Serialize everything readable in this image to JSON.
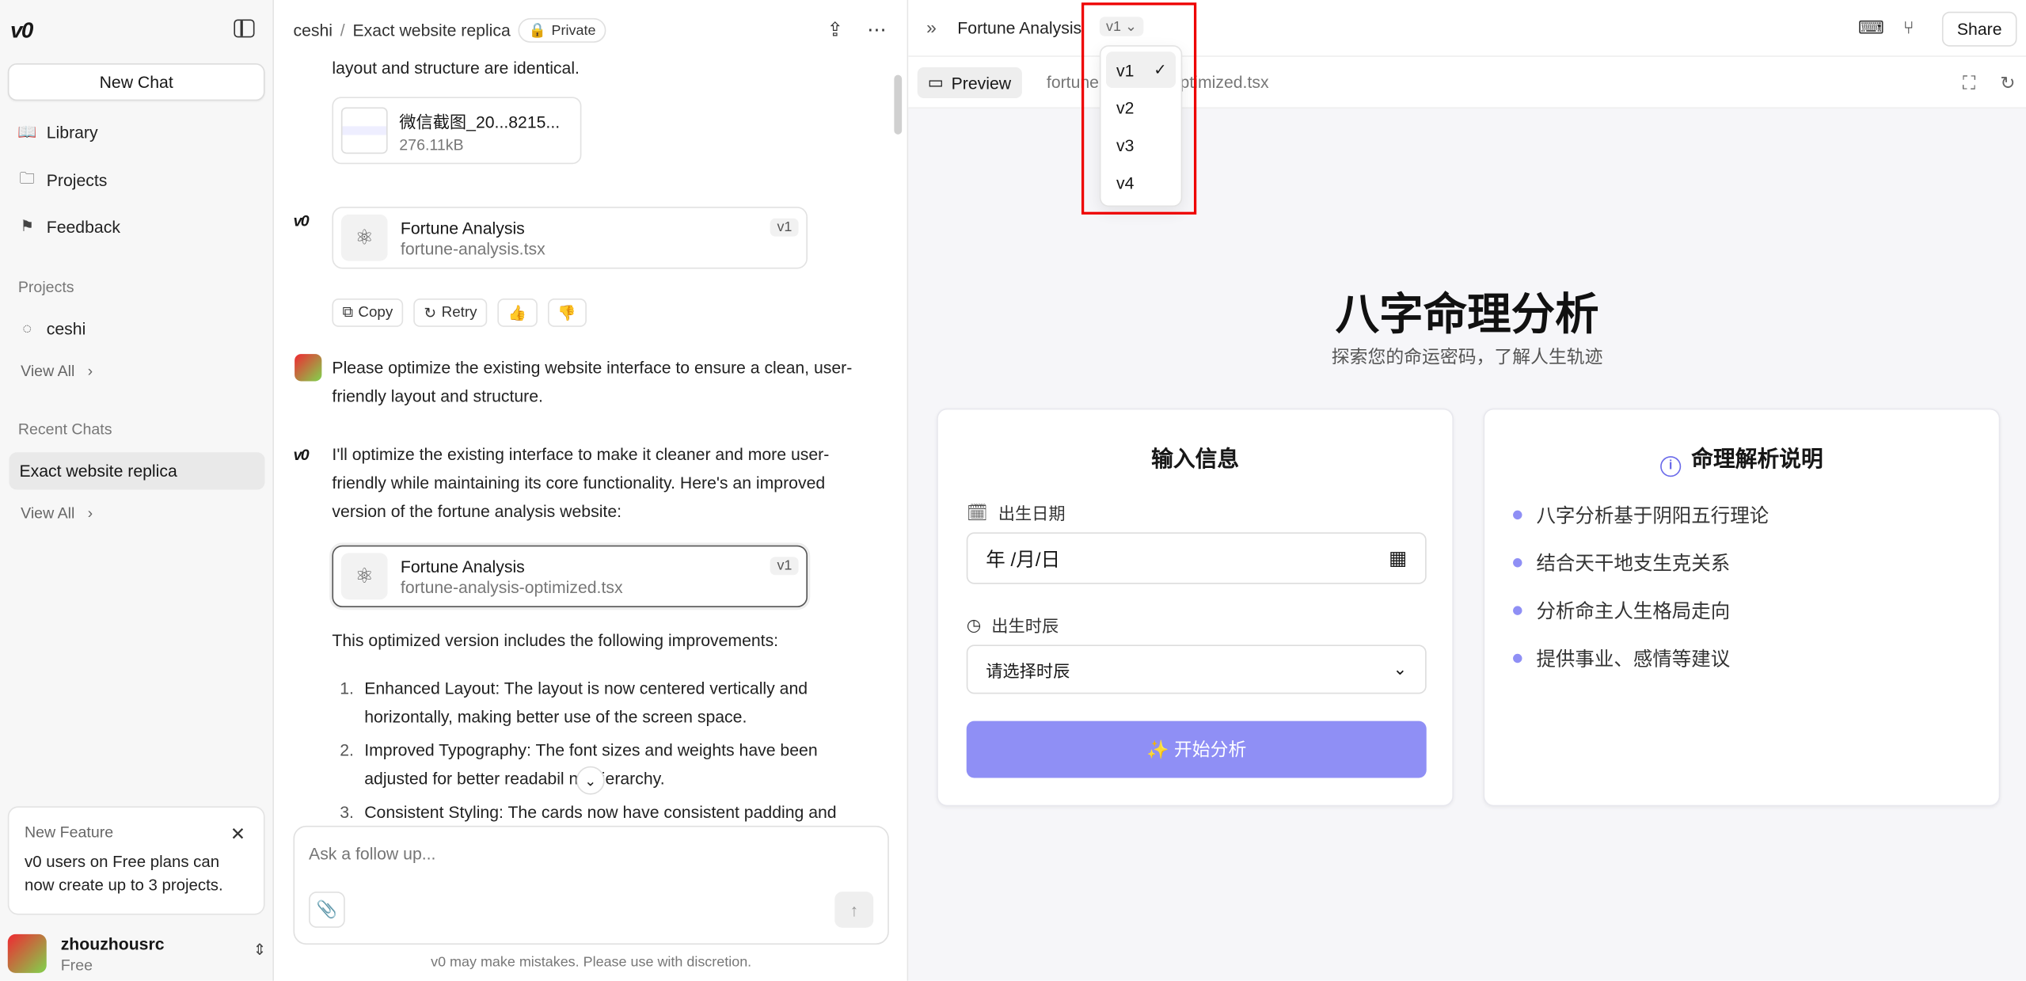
{
  "sidebar": {
    "logo": "v0",
    "new_chat": "New Chat",
    "nav": [
      {
        "label": "Library",
        "icon": "book-icon"
      },
      {
        "label": "Projects",
        "icon": "folder-icon"
      },
      {
        "label": "Feedback",
        "icon": "flag-icon"
      }
    ],
    "projects_label": "Projects",
    "project_name": "ceshi",
    "view_all": "View All",
    "recent_label": "Recent Chats",
    "recent_item": "Exact website replica",
    "feature": {
      "title": "New Feature",
      "body": "v0 users on Free plans can now create up to 3 projects."
    },
    "user": {
      "name": "zhouzhousrc",
      "plan": "Free"
    }
  },
  "chat": {
    "breadcrumb": {
      "project": "ceshi",
      "sep": "/",
      "chat": "Exact website replica",
      "privacy": "Private"
    },
    "intro_tail": "layout and structure are identical.",
    "attachment": {
      "name": "微信截图_20...8215...",
      "size": "276.11kB"
    },
    "card1": {
      "title": "Fortune Analysis",
      "file": "fortune-analysis.tsx",
      "version": "v1"
    },
    "actions": {
      "copy": "Copy",
      "retry": "Retry"
    },
    "user_msg": "Please optimize the existing website interface to ensure a clean, user-friendly layout and structure.",
    "bot_msg": "I'll optimize the existing interface to make it cleaner and more user-friendly while maintaining its core functionality. Here's an improved version of the fortune analysis website:",
    "card2": {
      "title": "Fortune Analysis",
      "file": "fortune-analysis-optimized.tsx",
      "version": "v1"
    },
    "improvements_intro": "This optimized version includes the following improvements:",
    "improvements": [
      {
        "num": "1.",
        "text": "Enhanced Layout: The layout is now centered vertically and horizontally, making better use of the screen space."
      },
      {
        "num": "2.",
        "text": "Improved Typography: The font sizes and weights have been adjusted for better readabil     nd hierarchy."
      },
      {
        "num": "3.",
        "text": "Consistent Styling: The cards now have consistent padding and"
      }
    ],
    "composer_placeholder": "Ask a follow up...",
    "disclaimer": "v0 may make mistakes. Please use with discretion."
  },
  "preview": {
    "title": "Fortune Analysis",
    "version": "v1",
    "share": "Share",
    "tab_preview": "Preview",
    "tab_file": "fortune-analysis-optimized.tsx",
    "versions": [
      "v1",
      "v2",
      "v3",
      "v4"
    ],
    "active_version": "v1",
    "app": {
      "title": "八字命理分析",
      "subtitle": "探索您的命运密码，了解人生轨迹",
      "input_panel": {
        "title": "输入信息",
        "date_label": "出生日期",
        "date_value": "年 /月/日",
        "time_label": "出生时辰",
        "time_placeholder": "请选择时辰",
        "submit": "✨ 开始分析"
      },
      "info_panel": {
        "title": "命理解析说明",
        "items": [
          "八字分析基于阴阳五行理论",
          "结合天干地支生克关系",
          "分析命主人生格局走向",
          "提供事业、感情等建议"
        ]
      }
    },
    "accent_color": "#8f8ff5",
    "highlight_color": "#ee0000"
  }
}
